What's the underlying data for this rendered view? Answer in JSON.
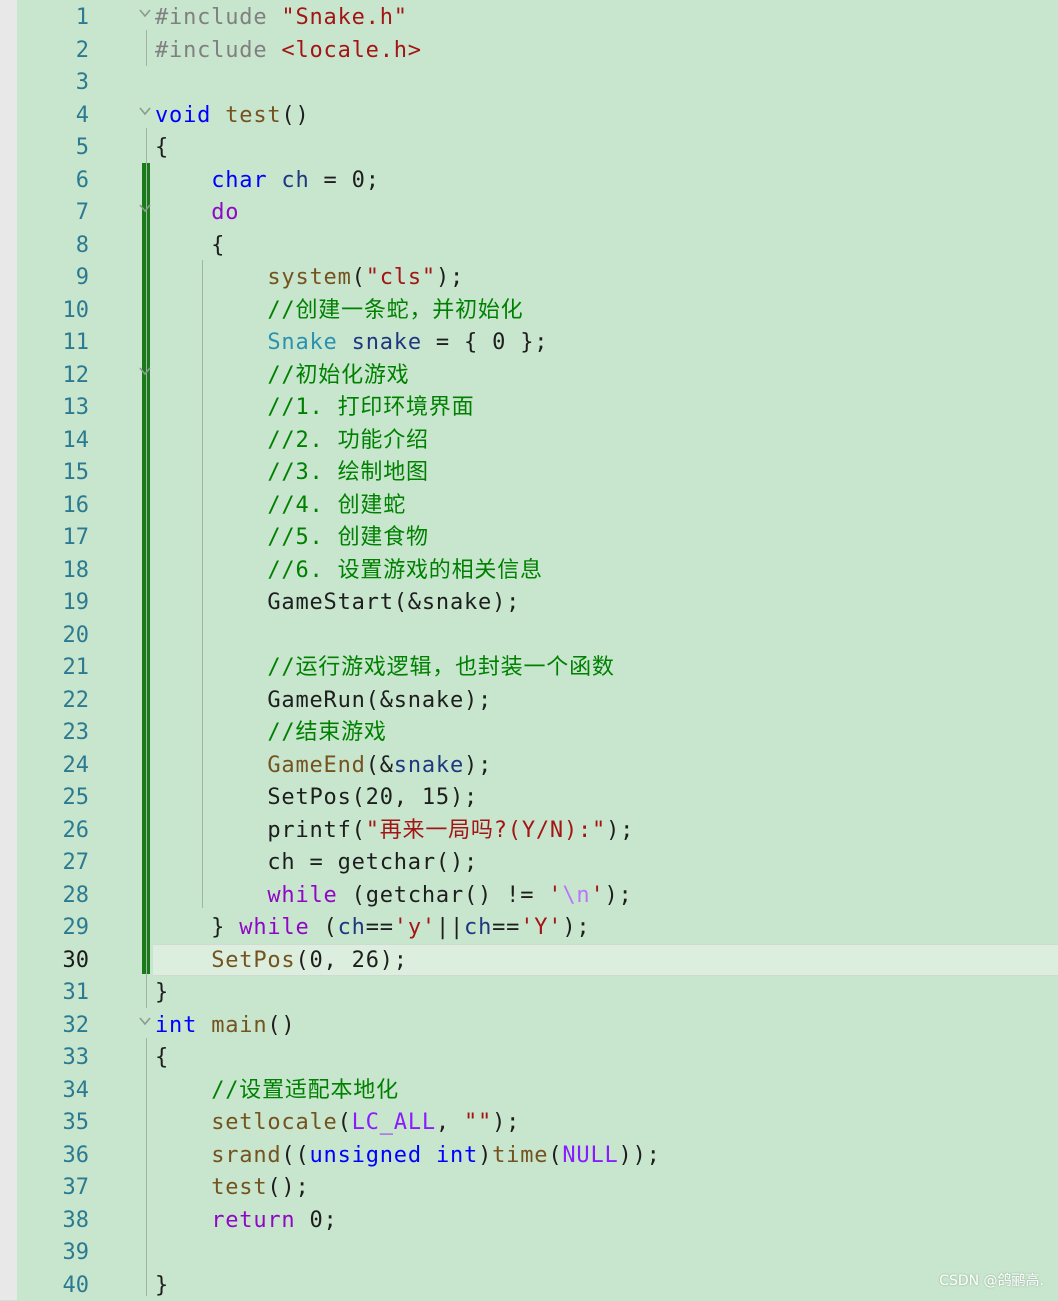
{
  "editor": {
    "current_line": 30,
    "lines": [
      {
        "n": "1",
        "fold": "open",
        "tokens": [
          {
            "c": "pp",
            "t": "#include "
          },
          {
            "c": "inc",
            "t": "\"Snake.h\""
          }
        ]
      },
      {
        "n": "2",
        "fold": "",
        "tokens": [
          {
            "c": "pp",
            "t": "#include "
          },
          {
            "c": "inc",
            "t": "<locale.h>"
          }
        ]
      },
      {
        "n": "3",
        "fold": "",
        "tokens": []
      },
      {
        "n": "4",
        "fold": "open",
        "tokens": [
          {
            "c": "kw",
            "t": "void"
          },
          {
            "c": "plain",
            "t": " "
          },
          {
            "c": "fn",
            "t": "test"
          },
          {
            "c": "plain",
            "t": "()"
          }
        ]
      },
      {
        "n": "5",
        "fold": "",
        "tokens": [
          {
            "c": "plain",
            "t": "{"
          }
        ]
      },
      {
        "n": "6",
        "fold": "",
        "tokens": [
          {
            "c": "plain",
            "t": "    "
          },
          {
            "c": "kw",
            "t": "char"
          },
          {
            "c": "plain",
            "t": " "
          },
          {
            "c": "var",
            "t": "ch"
          },
          {
            "c": "plain",
            "t": " = 0;"
          }
        ]
      },
      {
        "n": "7",
        "fold": "open",
        "tokens": [
          {
            "c": "plain",
            "t": "    "
          },
          {
            "c": "ctl",
            "t": "do"
          }
        ]
      },
      {
        "n": "8",
        "fold": "",
        "tokens": [
          {
            "c": "plain",
            "t": "    {"
          }
        ]
      },
      {
        "n": "9",
        "fold": "",
        "tokens": [
          {
            "c": "plain",
            "t": "        "
          },
          {
            "c": "fn",
            "t": "system"
          },
          {
            "c": "plain",
            "t": "("
          },
          {
            "c": "str",
            "t": "\"cls\""
          },
          {
            "c": "plain",
            "t": ");"
          }
        ]
      },
      {
        "n": "10",
        "fold": "",
        "tokens": [
          {
            "c": "plain",
            "t": "        "
          },
          {
            "c": "cmt",
            "t": "//创建一条蛇，并初始化"
          }
        ]
      },
      {
        "n": "11",
        "fold": "",
        "tokens": [
          {
            "c": "plain",
            "t": "        "
          },
          {
            "c": "type",
            "t": "Snake"
          },
          {
            "c": "plain",
            "t": " "
          },
          {
            "c": "var",
            "t": "snake"
          },
          {
            "c": "plain",
            "t": " = { 0 };"
          }
        ]
      },
      {
        "n": "12",
        "fold": "open",
        "tokens": [
          {
            "c": "plain",
            "t": "        "
          },
          {
            "c": "cmt",
            "t": "//初始化游戏"
          }
        ]
      },
      {
        "n": "13",
        "fold": "",
        "tokens": [
          {
            "c": "plain",
            "t": "        "
          },
          {
            "c": "cmt",
            "t": "//1. 打印环境界面"
          }
        ]
      },
      {
        "n": "14",
        "fold": "",
        "tokens": [
          {
            "c": "plain",
            "t": "        "
          },
          {
            "c": "cmt",
            "t": "//2. 功能介绍"
          }
        ]
      },
      {
        "n": "15",
        "fold": "",
        "tokens": [
          {
            "c": "plain",
            "t": "        "
          },
          {
            "c": "cmt",
            "t": "//3. 绘制地图"
          }
        ]
      },
      {
        "n": "16",
        "fold": "",
        "tokens": [
          {
            "c": "plain",
            "t": "        "
          },
          {
            "c": "cmt",
            "t": "//4. 创建蛇"
          }
        ]
      },
      {
        "n": "17",
        "fold": "",
        "tokens": [
          {
            "c": "plain",
            "t": "        "
          },
          {
            "c": "cmt",
            "t": "//5. 创建食物"
          }
        ]
      },
      {
        "n": "18",
        "fold": "",
        "tokens": [
          {
            "c": "plain",
            "t": "        "
          },
          {
            "c": "cmt",
            "t": "//6. 设置游戏的相关信息"
          }
        ]
      },
      {
        "n": "19",
        "fold": "",
        "tokens": [
          {
            "c": "plain",
            "t": "        GameStart(&snake);"
          }
        ]
      },
      {
        "n": "20",
        "fold": "",
        "tokens": []
      },
      {
        "n": "21",
        "fold": "",
        "tokens": [
          {
            "c": "plain",
            "t": "        "
          },
          {
            "c": "cmt",
            "t": "//运行游戏逻辑，也封装一个函数"
          }
        ]
      },
      {
        "n": "22",
        "fold": "",
        "tokens": [
          {
            "c": "plain",
            "t": "        GameRun(&snake);"
          }
        ]
      },
      {
        "n": "23",
        "fold": "",
        "tokens": [
          {
            "c": "plain",
            "t": "        "
          },
          {
            "c": "cmt",
            "t": "//结束游戏"
          }
        ]
      },
      {
        "n": "24",
        "fold": "",
        "tokens": [
          {
            "c": "plain",
            "t": "        "
          },
          {
            "c": "fn",
            "t": "GameEnd"
          },
          {
            "c": "plain",
            "t": "(&"
          },
          {
            "c": "var",
            "t": "snake"
          },
          {
            "c": "plain",
            "t": ");"
          }
        ]
      },
      {
        "n": "25",
        "fold": "",
        "tokens": [
          {
            "c": "plain",
            "t": "        SetPos(20, 15);"
          }
        ]
      },
      {
        "n": "26",
        "fold": "",
        "tokens": [
          {
            "c": "plain",
            "t": "        printf("
          },
          {
            "c": "str",
            "t": "\"再来一局吗?(Y/N):\""
          },
          {
            "c": "plain",
            "t": ");"
          }
        ]
      },
      {
        "n": "27",
        "fold": "",
        "tokens": [
          {
            "c": "plain",
            "t": "        ch = getchar();"
          }
        ]
      },
      {
        "n": "28",
        "fold": "",
        "tokens": [
          {
            "c": "plain",
            "t": "        "
          },
          {
            "c": "ctl",
            "t": "while"
          },
          {
            "c": "plain",
            "t": " (getchar() != "
          },
          {
            "c": "str",
            "t": "'"
          },
          {
            "c": "esc",
            "t": "\\n"
          },
          {
            "c": "str",
            "t": "'"
          },
          {
            "c": "plain",
            "t": ");"
          }
        ]
      },
      {
        "n": "29",
        "fold": "",
        "tokens": [
          {
            "c": "plain",
            "t": "    } "
          },
          {
            "c": "ctl",
            "t": "while"
          },
          {
            "c": "plain",
            "t": " ("
          },
          {
            "c": "var",
            "t": "ch"
          },
          {
            "c": "plain",
            "t": "=="
          },
          {
            "c": "str",
            "t": "'y'"
          },
          {
            "c": "plain",
            "t": "||"
          },
          {
            "c": "var",
            "t": "ch"
          },
          {
            "c": "plain",
            "t": "=="
          },
          {
            "c": "str",
            "t": "'Y'"
          },
          {
            "c": "plain",
            "t": ");"
          }
        ]
      },
      {
        "n": "30",
        "fold": "",
        "tokens": [
          {
            "c": "plain",
            "t": "    "
          },
          {
            "c": "fn",
            "t": "SetPos"
          },
          {
            "c": "plain",
            "t": "(0, 26);"
          }
        ]
      },
      {
        "n": "31",
        "fold": "",
        "tokens": [
          {
            "c": "plain",
            "t": "}"
          }
        ]
      },
      {
        "n": "32",
        "fold": "open",
        "tokens": [
          {
            "c": "kw",
            "t": "int"
          },
          {
            "c": "plain",
            "t": " "
          },
          {
            "c": "fn",
            "t": "main"
          },
          {
            "c": "plain",
            "t": "()"
          }
        ]
      },
      {
        "n": "33",
        "fold": "",
        "tokens": [
          {
            "c": "plain",
            "t": "{"
          }
        ]
      },
      {
        "n": "34",
        "fold": "",
        "tokens": [
          {
            "c": "plain",
            "t": "    "
          },
          {
            "c": "cmt",
            "t": "//设置适配本地化"
          }
        ]
      },
      {
        "n": "35",
        "fold": "",
        "tokens": [
          {
            "c": "plain",
            "t": "    "
          },
          {
            "c": "fn",
            "t": "setlocale"
          },
          {
            "c": "plain",
            "t": "("
          },
          {
            "c": "mac",
            "t": "LC_ALL"
          },
          {
            "c": "plain",
            "t": ", "
          },
          {
            "c": "str",
            "t": "\"\""
          },
          {
            "c": "plain",
            "t": ");"
          }
        ]
      },
      {
        "n": "36",
        "fold": "",
        "tokens": [
          {
            "c": "plain",
            "t": "    "
          },
          {
            "c": "fn",
            "t": "srand"
          },
          {
            "c": "plain",
            "t": "(("
          },
          {
            "c": "kw",
            "t": "unsigned"
          },
          {
            "c": "plain",
            "t": " "
          },
          {
            "c": "kw",
            "t": "int"
          },
          {
            "c": "plain",
            "t": ")"
          },
          {
            "c": "fn",
            "t": "time"
          },
          {
            "c": "plain",
            "t": "("
          },
          {
            "c": "mac",
            "t": "NULL"
          },
          {
            "c": "plain",
            "t": "));"
          }
        ]
      },
      {
        "n": "37",
        "fold": "",
        "tokens": [
          {
            "c": "plain",
            "t": "    "
          },
          {
            "c": "fn",
            "t": "test"
          },
          {
            "c": "plain",
            "t": "();"
          }
        ]
      },
      {
        "n": "38",
        "fold": "",
        "tokens": [
          {
            "c": "plain",
            "t": "    "
          },
          {
            "c": "ctl",
            "t": "return"
          },
          {
            "c": "plain",
            "t": " 0;"
          }
        ]
      },
      {
        "n": "39",
        "fold": "",
        "tokens": []
      },
      {
        "n": "40",
        "fold": "",
        "tokens": [
          {
            "c": "plain",
            "t": "}"
          }
        ]
      }
    ]
  },
  "watermark": "CSDN @鸽鹂高."
}
